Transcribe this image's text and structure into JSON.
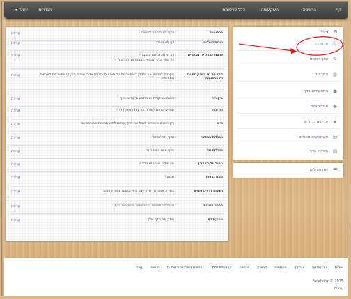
{
  "topbar": {
    "items": [
      "דף",
      "הרשמה",
      "השקעותה",
      "כלל פרסומת",
      "הגדרות",
      "עזרה ▾"
    ]
  },
  "sidebar": {
    "title": "כללי",
    "items": [
      {
        "label": "פרטי דף",
        "icon": "info-icon"
      },
      {
        "label": "שיוך המשט",
        "icon": "edit-icon"
      },
      {
        "label": "התראות",
        "icon": "globe-icon"
      },
      {
        "label": "התפקידים בדף",
        "icon": "person-icon"
      },
      {
        "label": "אפליקציות",
        "icon": "puzzle-icon"
      },
      {
        "label": "פריטים נבחרים",
        "icon": "star-icon"
      },
      {
        "label": "משתמשים אסורים",
        "icon": "people-icon"
      },
      {
        "label": "תפקיד בדף",
        "icon": "role-icon"
      }
    ],
    "ads_label": "יומן פעילות"
  },
  "settings": {
    "edit_label": "עריכה",
    "rows": [
      {
        "label": "פרסומים",
        "value": "הדף לא מוסתר למנויים"
      },
      {
        "label": "העדפת יעדים",
        "value": "דף לא מוגדר"
      },
      {
        "label": "פרסומים על ידי מבקרים",
        "value": [
          "כל מי שיכול לפרסם בדף",
          "כל אחד יכול להוסיף תמונות וסרטונים לדף"
        ]
      },
      {
        "label": "קהל על ידי המבקרים על ידי פרסומים",
        "value": "הערכת לפרסם את היקוק האפשרויות על תוספות והדעת אחרי מגביל היקוקי אפשרויות לאנשים מתחיילים"
      },
      {
        "label": "ביקורות",
        "value": "הצגת הביקורת או מחפש ביקורות בדף"
      },
      {
        "label": "הודעות",
        "value": "אנשים יכולים לשלוח הודעות פרטיות לדף"
      },
      {
        "label": "תיוג",
        "value": "רק אנשים שעוזרים לנהל את הדף יכולים לתייג תמונות שפורסמו בו"
      },
      {
        "label": "הגבלות המדינה",
        "value": "הדף גלוי לכולם"
      },
      {
        "label": "הגבלות גיל",
        "value": "הדף מוצג בפני כולם"
      },
      {
        "label": "ניהול על ידי תוכן",
        "value": "אין מילים שנחסמו מהדף"
      },
      {
        "label": "מסנן גסויות",
        "value": "מבוטל"
      },
      {
        "label": "הצעות לדפים דומים",
        "value": "בחירה אם הדף שלך יוצע כדף מקושר בפני אחרים"
      },
      {
        "label": "מספר תגובות",
        "value": "הגבלת התמונות והסרטונים שנחשפים בדף"
      },
      {
        "label": "מחיקת דף",
        "value": "מחק את הדף שלך"
      }
    ]
  },
  "footer": {
    "links": [
      "אודות",
      "צור מודעה",
      "צור דף",
      "מפתחים",
      "קריירה",
      "פרטיות",
      "קבצי Cookies",
      "בחירת בשלבי מודעות ▷",
      "תנאים",
      "עזרה"
    ],
    "copyright": "Facebook © 2015",
    "language": "עברית"
  },
  "colors": {
    "link": "#3b5998",
    "annotation": "#e02020",
    "topbar": "#4a4a4a"
  }
}
